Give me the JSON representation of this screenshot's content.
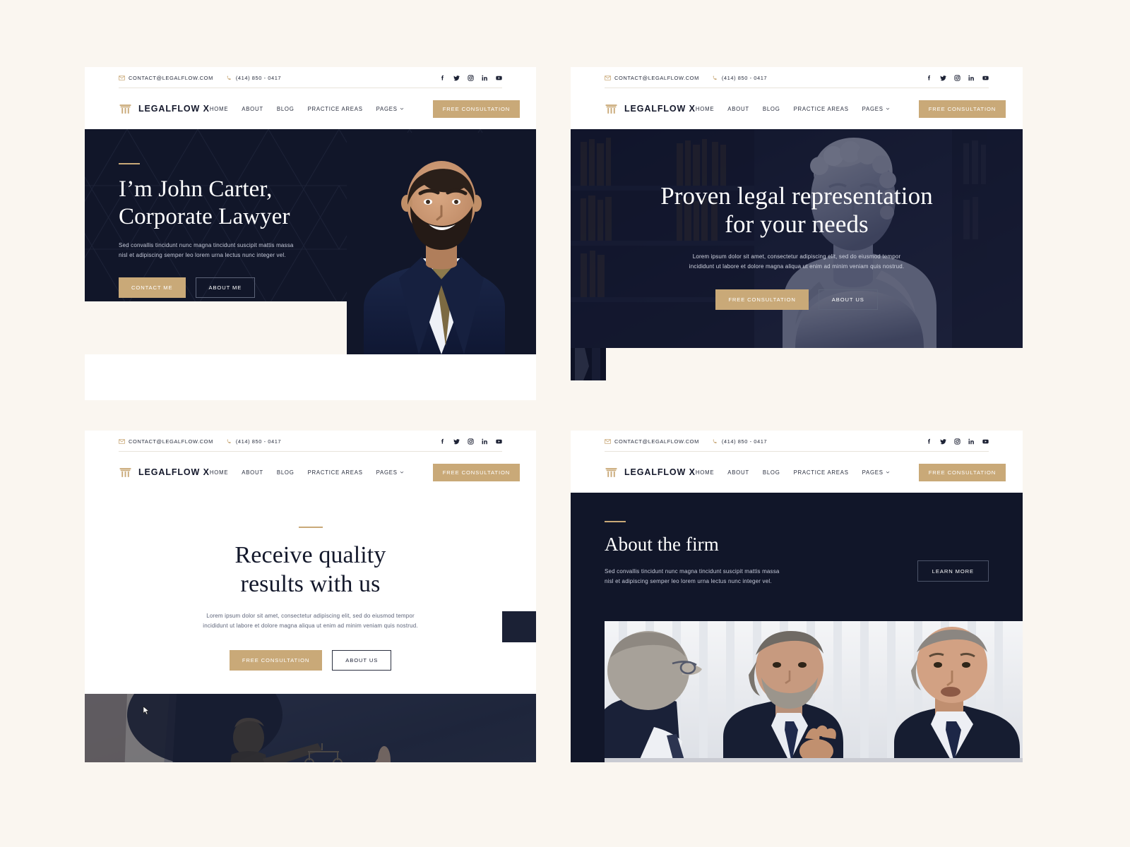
{
  "page": {
    "background_color": "#faf6f0",
    "accent_gold": "#c9a978",
    "dark_navy": "#111629"
  },
  "topbar": {
    "email": "CONTACT@LEGALFLOW.COM",
    "phone": "(414) 850 - 0417",
    "email_icon": "envelope-icon",
    "phone_icon": "phone-icon",
    "socials": [
      {
        "name": "facebook-icon",
        "label": "Facebook"
      },
      {
        "name": "twitter-icon",
        "label": "Twitter"
      },
      {
        "name": "instagram-icon",
        "label": "Instagram"
      },
      {
        "name": "linkedin-icon",
        "label": "LinkedIn"
      },
      {
        "name": "youtube-icon",
        "label": "YouTube"
      }
    ]
  },
  "brand": {
    "name": "LEGALFLOW X",
    "mark": "column-pillar-icon"
  },
  "nav": {
    "items": [
      {
        "label": "HOME",
        "has_caret": false
      },
      {
        "label": "ABOUT",
        "has_caret": false
      },
      {
        "label": "BLOG",
        "has_caret": false
      },
      {
        "label": "PRACTICE AREAS",
        "has_caret": false
      },
      {
        "label": "PAGES",
        "has_caret": true
      }
    ],
    "cta_label": "FREE CONSULTATION"
  },
  "panels": [
    {
      "id": "panel-1",
      "kind": "hero-portrait-dark",
      "title_line_1": "I’m John Carter,",
      "title_line_2": "Corporate Lawyer",
      "subtitle_line_1": "Sed convallis tincidunt nunc magna tincidunt suscipit mattis massa",
      "subtitle_line_2": "nisl et adipiscing semper leo lorem urna lectus nunc integer vel.",
      "primary_button": "CONTACT ME",
      "secondary_button": "ABOUT ME",
      "image_alt": "smiling-bearded-lawyer-portrait"
    },
    {
      "id": "panel-2",
      "kind": "hero-statue-centered",
      "title_line_1": "Proven legal representation",
      "title_line_2": "for your needs",
      "subtitle_line_1": "Lorem ipsum dolor sit amet, consectetur adipiscing elit, sed do eiusmod tempor",
      "subtitle_line_2": "incididunt ut labore et dolore magna aliqua ut enim ad minim veniam quis nostrud.",
      "primary_button": "FREE CONSULTATION",
      "secondary_button": "ABOUT US",
      "image_alt": "classical-marble-bust-in-library"
    },
    {
      "id": "panel-3",
      "kind": "hero-light-centered",
      "title_line_1": "Receive quality",
      "title_line_2": "results with us",
      "subtitle_line_1": "Lorem ipsum dolor sit amet, consectetur adipiscing elit, sed do eiusmod tempor",
      "subtitle_line_2": "incididunt ut labore et dolore magna aliqua ut enim ad minim veniam quis nostrud.",
      "primary_button": "FREE CONSULTATION",
      "secondary_button": "ABOUT US",
      "image_alt": "lady-justice-statue-with-scales"
    },
    {
      "id": "panel-4",
      "kind": "about-dark-with-photo",
      "title_line_1": "About the firm",
      "subtitle_line_1": "Sed convallis tincidunt nunc magna tincidunt suscipit mattis massa",
      "subtitle_line_2": "nisl et adipiscing semper leo lorem urna lectus nunc integer vel.",
      "primary_button": "LEARN MORE",
      "image_alt": "three-businessmen-meeting-at-table"
    }
  ]
}
